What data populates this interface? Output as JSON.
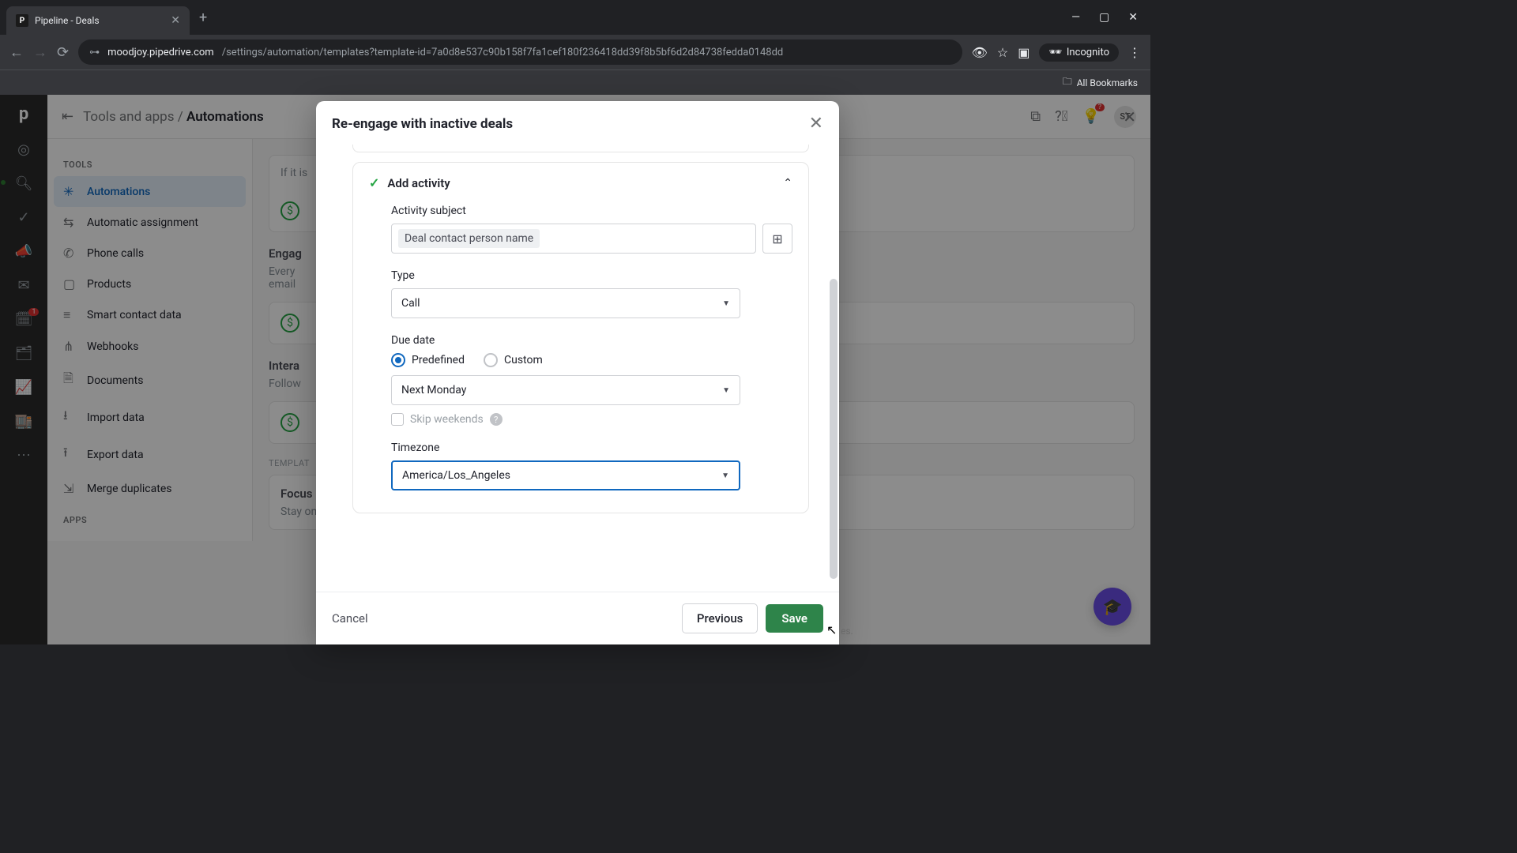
{
  "browser": {
    "tab_title": "Pipeline - Deals",
    "tab_favicon_letter": "P",
    "url_host": "moodjoy.pipedrive.com",
    "url_path": "/settings/automation/templates?template-id=7a0d8e537c90b158f7fa1cef180f236418dd39f8b5bf6d2d84738fedda0148dd",
    "incognito_label": "Incognito",
    "all_bookmarks": "All Bookmarks"
  },
  "topbar": {
    "breadcrumb_parent": "Tools and apps",
    "breadcrumb_current": "Automations",
    "avatar_initials": "ST",
    "bulb_badge": "?"
  },
  "sidebar": {
    "sections": {
      "tools_label": "TOOLS",
      "apps_label": "APPS"
    },
    "items": [
      {
        "label": "Automations",
        "icon": "⚙",
        "active": true
      },
      {
        "label": "Automatic assignment",
        "icon": "⇆"
      },
      {
        "label": "Phone calls",
        "icon": "✆"
      },
      {
        "label": "Products",
        "icon": "▢"
      },
      {
        "label": "Smart contact data",
        "icon": "☰"
      },
      {
        "label": "Webhooks",
        "icon": "⋔"
      },
      {
        "label": "Documents",
        "icon": "🗎"
      },
      {
        "label": "Import data",
        "icon": "⭳"
      },
      {
        "label": "Export data",
        "icon": "⭱"
      },
      {
        "label": "Merge duplicates",
        "icon": "⇲"
      }
    ]
  },
  "rail": {
    "mail_badge": "1"
  },
  "background": {
    "if_text": "If it is",
    "engage_heading": "Engag",
    "engage_line1": "Every",
    "engage_line2": "email",
    "intera_heading": "Intera",
    "intera_line": "Follow",
    "template_label": "TEMPLAT",
    "focus_title": "Focus",
    "focus_sub": "Stay on",
    "count_pill": "7",
    "trailing": "es."
  },
  "modal": {
    "title": "Re-engage with inactive deals",
    "card_title": "Add activity",
    "labels": {
      "activity_subject": "Activity subject",
      "type": "Type",
      "due_date": "Due date",
      "predefined": "Predefined",
      "custom": "Custom",
      "skip_weekends": "Skip weekends",
      "timezone": "Timezone"
    },
    "values": {
      "subject_chip": "Deal contact person name",
      "type_value": "Call",
      "due_value": "Next Monday",
      "timezone_value": "America/Los_Angeles"
    },
    "footer": {
      "cancel": "Cancel",
      "previous": "Previous",
      "save": "Save"
    }
  }
}
